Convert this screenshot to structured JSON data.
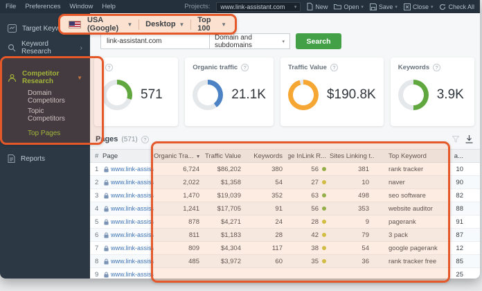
{
  "menubar": {
    "menus": [
      "File",
      "Preferences",
      "Window",
      "Help"
    ],
    "projects_label": "Projects:",
    "project_name": "www.link-assistant.com",
    "buttons": {
      "new": "New",
      "open": "Open",
      "save": "Save",
      "close": "Close",
      "check_all": "Check All"
    }
  },
  "context_bar": {
    "flag": "us-flag-icon",
    "search_engine": "USA (Google)",
    "device": "Desktop",
    "depth": "Top 100"
  },
  "sidebar": {
    "target_keywords": "Target Keywords",
    "keyword_research": "Keyword Research",
    "competitor_research": "Competitor Research",
    "sub_items": [
      "Domain Competitors",
      "Topic Competitors",
      "Top Pages"
    ],
    "active_sub_item": "Top Pages",
    "reports": "Reports"
  },
  "search": {
    "query": "link-assistant.com",
    "scope": "Domain and subdomains",
    "button_label": "Search"
  },
  "metrics": [
    {
      "label": "",
      "value": "571",
      "percent": 30,
      "color": "#5fa73e"
    },
    {
      "label": "Organic traffic",
      "value": "21.1K",
      "percent": 40,
      "color": "#4d83c4"
    },
    {
      "label": "Traffic Value",
      "value": "$190.8K",
      "percent": 96,
      "color": "#f5a633"
    },
    {
      "label": "Keywords",
      "value": "3.9K",
      "percent": 50,
      "color": "#5fa73e"
    }
  ],
  "table": {
    "title": "Pages",
    "count": "(571)",
    "headers": [
      "#",
      "Page",
      "Organic Tra...",
      "Traffic Value",
      "Keywords",
      "Page InLink R...",
      "Sites Linking t...",
      "Top Keyword",
      "a..."
    ],
    "sort_column_index": 2,
    "rows": [
      {
        "num": "1",
        "page": "www.link-assistant.com…",
        "organic_traffic": "6,724",
        "traffic_value": "$86,202",
        "keywords": "380",
        "page_inlink_rank": "56",
        "inlink_status": "green",
        "sites_linking": "381",
        "top_keyword": "rank tracker",
        "extra": "10"
      },
      {
        "num": "2",
        "page": "www.link-assistant.com…",
        "organic_traffic": "2,022",
        "traffic_value": "$1,358",
        "keywords": "54",
        "page_inlink_rank": "27",
        "inlink_status": "yellow",
        "sites_linking": "10",
        "top_keyword": "naver",
        "extra": "90"
      },
      {
        "num": "3",
        "page": "www.link-assistant.com…",
        "organic_traffic": "1,470",
        "traffic_value": "$19,039",
        "keywords": "352",
        "page_inlink_rank": "63",
        "inlink_status": "green",
        "sites_linking": "498",
        "top_keyword": "seo software",
        "extra": "82"
      },
      {
        "num": "4",
        "page": "www.link-assistant.com…",
        "organic_traffic": "1,241",
        "traffic_value": "$17,705",
        "keywords": "91",
        "page_inlink_rank": "56",
        "inlink_status": "green",
        "sites_linking": "353",
        "top_keyword": "website auditor",
        "extra": "88"
      },
      {
        "num": "5",
        "page": "www.link-assistant.com…",
        "organic_traffic": "878",
        "traffic_value": "$4,271",
        "keywords": "24",
        "page_inlink_rank": "28",
        "inlink_status": "yellow",
        "sites_linking": "9",
        "top_keyword": "pagerank",
        "extra": "91"
      },
      {
        "num": "6",
        "page": "www.link-assistant.com…",
        "organic_traffic": "811",
        "traffic_value": "$1,183",
        "keywords": "28",
        "page_inlink_rank": "42",
        "inlink_status": "yellow",
        "sites_linking": "79",
        "top_keyword": "3 pack",
        "extra": "87"
      },
      {
        "num": "7",
        "page": "www.link-assistant.com…",
        "organic_traffic": "809",
        "traffic_value": "$4,304",
        "keywords": "117",
        "page_inlink_rank": "38",
        "inlink_status": "yellow",
        "sites_linking": "54",
        "top_keyword": "google pagerank",
        "extra": "12"
      },
      {
        "num": "8",
        "page": "www.link-assistant.com…",
        "organic_traffic": "485",
        "traffic_value": "$3,972",
        "keywords": "60",
        "page_inlink_rank": "35",
        "inlink_status": "yellow",
        "sites_linking": "36",
        "top_keyword": "rank tracker free",
        "extra": "85"
      },
      {
        "num": "9",
        "page": "www.link-assistant.com…",
        "organic_traffic": "",
        "traffic_value": "",
        "keywords": "",
        "page_inlink_rank": "",
        "inlink_status": "",
        "sites_linking": "",
        "top_keyword": "",
        "extra": "25"
      }
    ]
  },
  "status_colors": {
    "green": "#7cb342",
    "yellow": "#c9c43a"
  }
}
